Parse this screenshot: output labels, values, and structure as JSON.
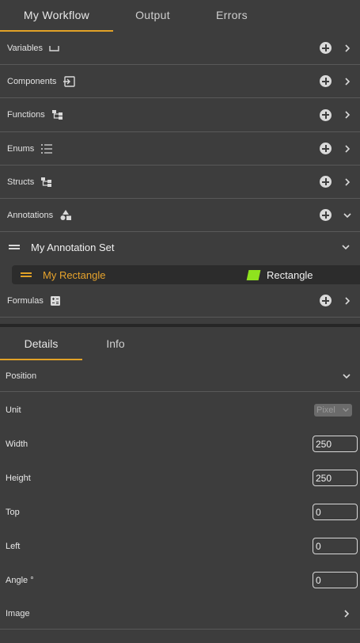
{
  "top_tabs": [
    {
      "label": "My Workflow",
      "active": true
    },
    {
      "label": "Output",
      "active": false
    },
    {
      "label": "Errors",
      "active": false
    }
  ],
  "categories": [
    {
      "label": "Variables",
      "icon": "variable-icon",
      "expanded": false
    },
    {
      "label": "Components",
      "icon": "component-icon",
      "expanded": false
    },
    {
      "label": "Functions",
      "icon": "function-tree-icon",
      "expanded": false
    },
    {
      "label": "Enums",
      "icon": "list-icon",
      "expanded": false
    },
    {
      "label": "Structs",
      "icon": "struct-tree-icon",
      "expanded": false
    },
    {
      "label": "Annotations",
      "icon": "shapes-icon",
      "expanded": true
    }
  ],
  "annotation_set": {
    "title": "My Annotation Set"
  },
  "annotation_item": {
    "name": "My Rectangle",
    "type": "Rectangle",
    "swatch_color": "#8fe31e"
  },
  "formulas": {
    "label": "Formulas",
    "icon": "calculator-icon"
  },
  "detail_tabs": [
    {
      "label": "Details",
      "active": true
    },
    {
      "label": "Info",
      "active": false
    }
  ],
  "position_section": {
    "label": "Position",
    "expanded": true
  },
  "properties": {
    "unit": {
      "label": "Unit",
      "value": "Pixel"
    },
    "width": {
      "label": "Width",
      "value": "250"
    },
    "height": {
      "label": "Height",
      "value": "250"
    },
    "top": {
      "label": "Top",
      "value": "0"
    },
    "left": {
      "label": "Left",
      "value": "0"
    },
    "angle": {
      "label": "Angle °",
      "value": "0"
    }
  },
  "image_section": {
    "label": "Image",
    "expanded": false
  },
  "colors": {
    "accent": "#e2a227",
    "background": "#3d3d3d",
    "annotation_highlight": "#e6a32d"
  }
}
